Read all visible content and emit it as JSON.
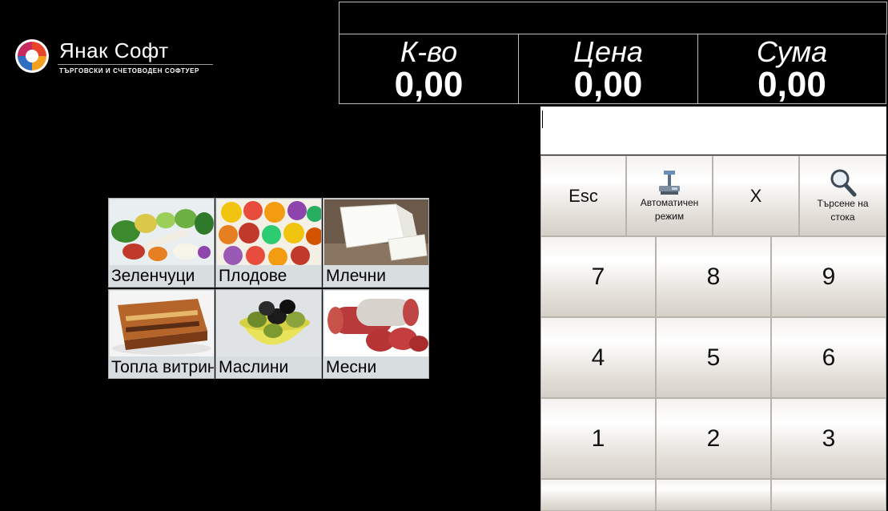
{
  "logo": {
    "title": "Янак Софт",
    "subtitle": "ТЪРГОВСКИ И СЧЕТОВОДЕН СОФТУЕР",
    "icon": "yanak-logo-icon"
  },
  "display": {
    "quantity_label": "К-во",
    "quantity_value": "0,00",
    "price_label": "Цена",
    "price_value": "0,00",
    "sum_label": "Сума",
    "sum_value": "0,00"
  },
  "input": {
    "value": ""
  },
  "keypad": {
    "esc": "Esc",
    "auto_mode": "Автоматичен режим",
    "auto_mode_icon": "scale-icon",
    "multiply": "X",
    "search": "Търсене на стока",
    "search_icon": "magnifier-icon",
    "digits": [
      "7",
      "8",
      "9",
      "4",
      "5",
      "6",
      "1",
      "2",
      "3"
    ]
  },
  "categories": [
    {
      "label": "Зеленчуци",
      "icon": "vegetables-image"
    },
    {
      "label": "Плодове",
      "icon": "fruits-image"
    },
    {
      "label": "Млечни",
      "icon": "cheese-image"
    },
    {
      "label": "Топла витрина",
      "icon": "moussaka-image"
    },
    {
      "label": "Маслини",
      "icon": "olives-image"
    },
    {
      "label": "Месни",
      "icon": "salami-image"
    }
  ],
  "colors": {
    "background": "#000000",
    "display_border": "#bdbdbd",
    "tile_background": "#d8dde0",
    "key_border": "#b8b3ab"
  }
}
